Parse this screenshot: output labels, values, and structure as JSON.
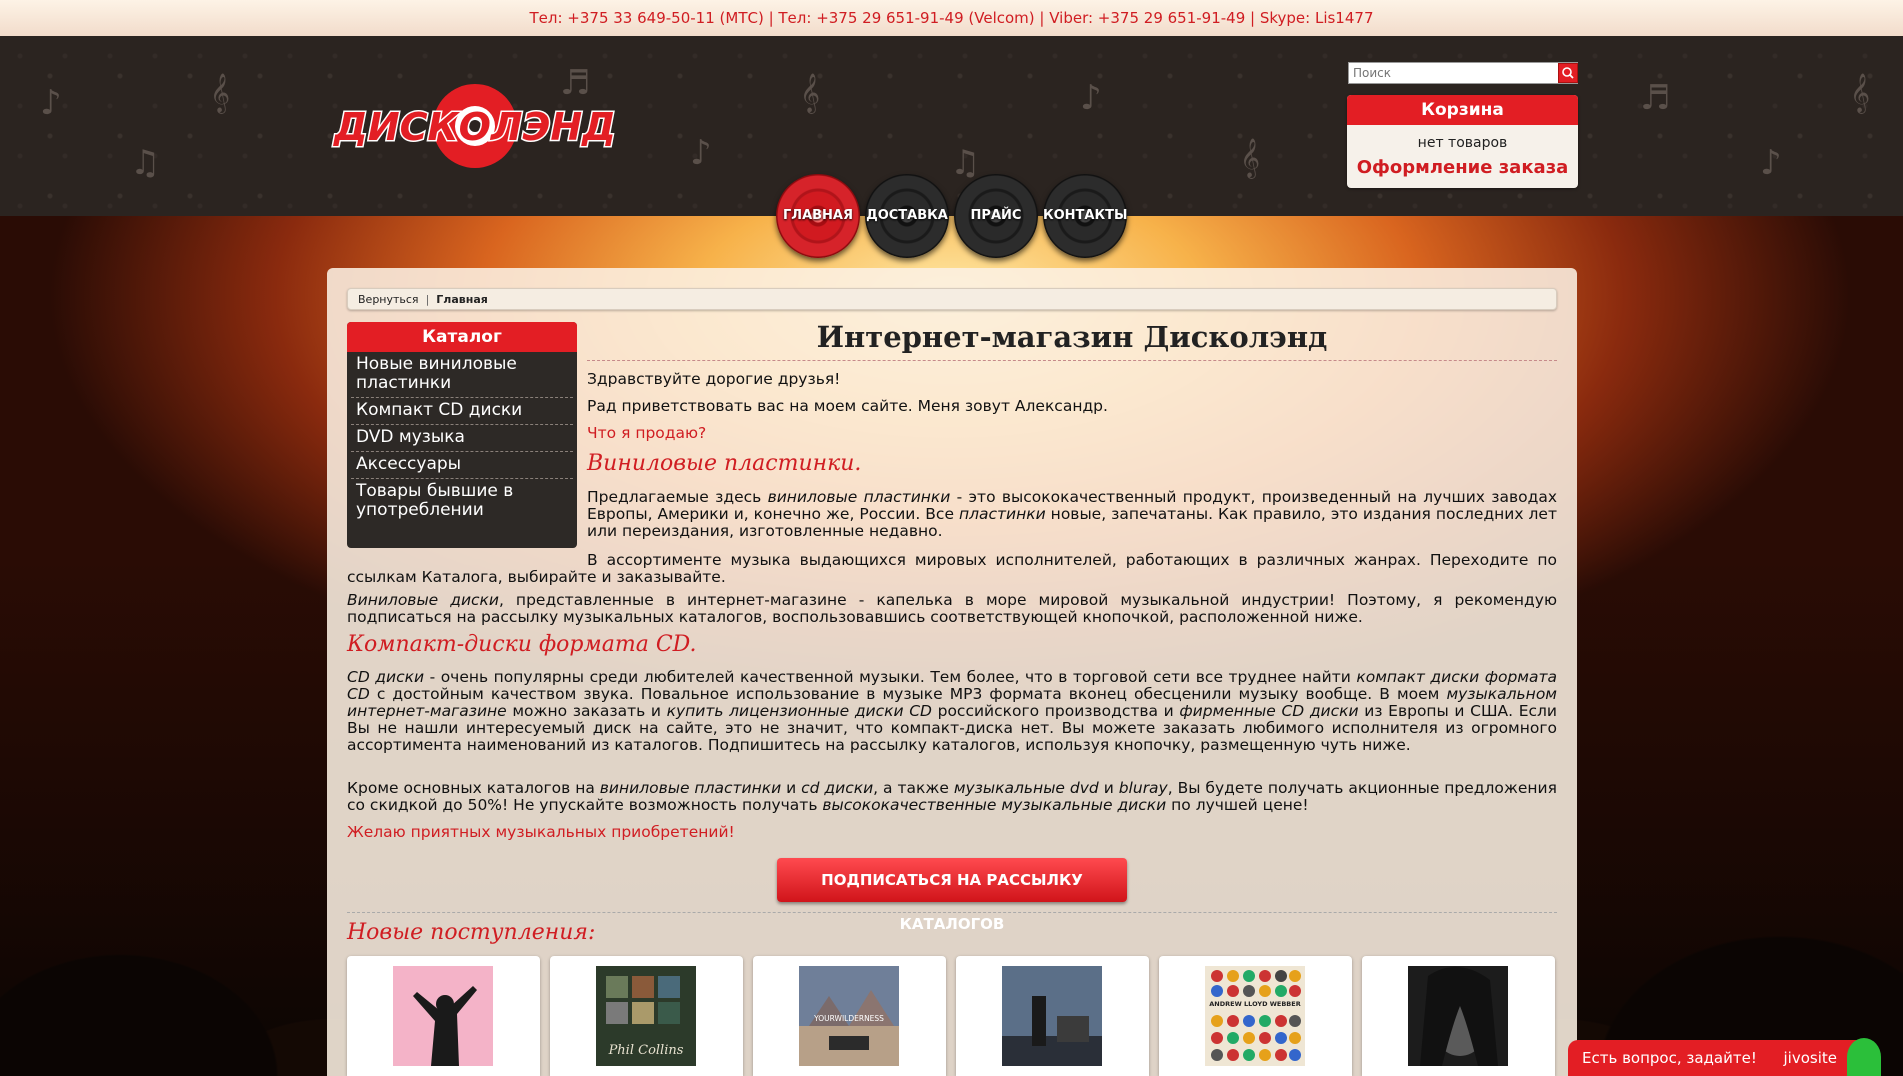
{
  "topbar": {
    "contacts": "Тел: +375 33 649-50-11 (МТС) | Тел: +375 29 651-91-49 (Velcom) | Viber: +375 29 651-91-49 | Skype: Lis1477"
  },
  "header": {
    "logo_text": "ДИСКОЛЭНД",
    "search_placeholder": "Поиск"
  },
  "cart": {
    "title": "Корзина",
    "empty": "нет товаров",
    "order": "Оформление заказа"
  },
  "nav": [
    {
      "label": "ГЛАВНАЯ",
      "active": true
    },
    {
      "label": "ДОСТАВКА",
      "active": false
    },
    {
      "label": "ПРАЙС",
      "active": false
    },
    {
      "label": "КОНТАКТЫ",
      "active": false
    }
  ],
  "breadcrumb": {
    "back": "Вернуться",
    "current": "Главная"
  },
  "catalog": {
    "title": "Каталог",
    "items": [
      "Новые виниловые пластинки",
      "Компакт CD диски",
      "DVD музыка",
      "Аксессуары",
      "Товары бывшие в употреблении"
    ]
  },
  "content": {
    "title": "Интернет-магазин Дисколэнд",
    "greeting": "Здравствуйте дорогие друзья!",
    "intro": "Рад приветствовать вас на моем сайте. Меня зовут Александр.",
    "what_sell": "Что я продаю?",
    "vinyl_heading": "Виниловые пластинки.",
    "vinyl_p1_a": "Предлагаемые здесь ",
    "vinyl_p1_i1": "виниловые пластинки",
    "vinyl_p1_b": " - это высококачественный продукт, произведенный на лучших заводах Европы, Америки и, конечно же, России. Все ",
    "vinyl_p1_i2": "пластинки",
    "vinyl_p1_c": " новые, запечатаны. Как правило, это издания последних лет или переиздания, изготовленные недавно.",
    "vinyl_p2": "В ассортименте музыка выдающихся мировых исполнителей, работающих в различных жанрах. Переходите по ссылкам Каталога, выбирайте и заказывайте.",
    "vinyl_p3_i": "Виниловые диски",
    "vinyl_p3_b": ", представленные в интернет-магазине - капелька в море мировой музыкальной индустрии! Поэтому, я рекомендую подписаться на рассылку музыкальных каталогов, воспользовавшись соответствующей кнопочкой, расположенной ниже.",
    "cd_heading": "Компакт-диски формата CD.",
    "cd_p1_i1": "CD диски",
    "cd_p1_a": " - очень популярны среди любителей качественной музыки. Тем более, что в торговой сети все труднее найти ",
    "cd_p1_i2": "компакт диски формата CD",
    "cd_p1_b": " с достойным качеством звука. Повальное использование в музыке MP3 формата вконец обесценили музыку вообще. В моем ",
    "cd_p1_i3": "музыкальном интернет-магазине",
    "cd_p1_c": " можно заказать и ",
    "cd_p1_i4": "купить лицензионные диски CD",
    "cd_p1_d": " российского производства и ",
    "cd_p1_i5": "фирменные CD диски",
    "cd_p1_e": " из Европы и США. Если Вы не нашли интересуемый диск на сайте, это не значит, что компакт-диска нет. Вы можете заказать любимого исполнителя из огромного ассортимента наименований из каталогов. Подпишитесь на рассылку каталогов, используя кнопочку, размещенную чуть ниже.",
    "cd_p2_a": "Кроме основных каталогов на ",
    "cd_p2_i1": "виниловые пластинки",
    "cd_p2_b": " и ",
    "cd_p2_i2": "cd диски",
    "cd_p2_c": ", а также ",
    "cd_p2_i3": "музыкальные dvd",
    "cd_p2_d": " и ",
    "cd_p2_i4": "bluray",
    "cd_p2_e": ", Вы будете получать акционные предложения со скидкой до 50%! Не упускайте возможность получать ",
    "cd_p2_i5": "высококачественные музыкальные диски",
    "cd_p2_f": " по лучшей цене!",
    "wish": "Желаю приятных музыкальных приобретений!",
    "subscribe_button": "ПОДПИСАТЬСЯ НА РАССЫЛКУ КАТАЛОГОВ",
    "new_arrivals": "Новые поступления:"
  },
  "covers": [
    {
      "label": "",
      "bg": "#f4b3c8"
    },
    {
      "label": "Phil Collins",
      "bg": "#2c3a2a"
    },
    {
      "label": "YOURWILDERNESS",
      "bg": "#6f7f99"
    },
    {
      "label": "",
      "bg": "#5b6f88"
    },
    {
      "label": "ANDREW LLOYD WEBBER",
      "bg": "#efe6d4"
    },
    {
      "label": "",
      "bg": "#3a3a3a"
    }
  ],
  "chat": {
    "prompt": "Есть вопрос, задайте!",
    "brand": "jivosite"
  },
  "colors": {
    "accent": "#e31e24",
    "link": "#d01d22"
  }
}
